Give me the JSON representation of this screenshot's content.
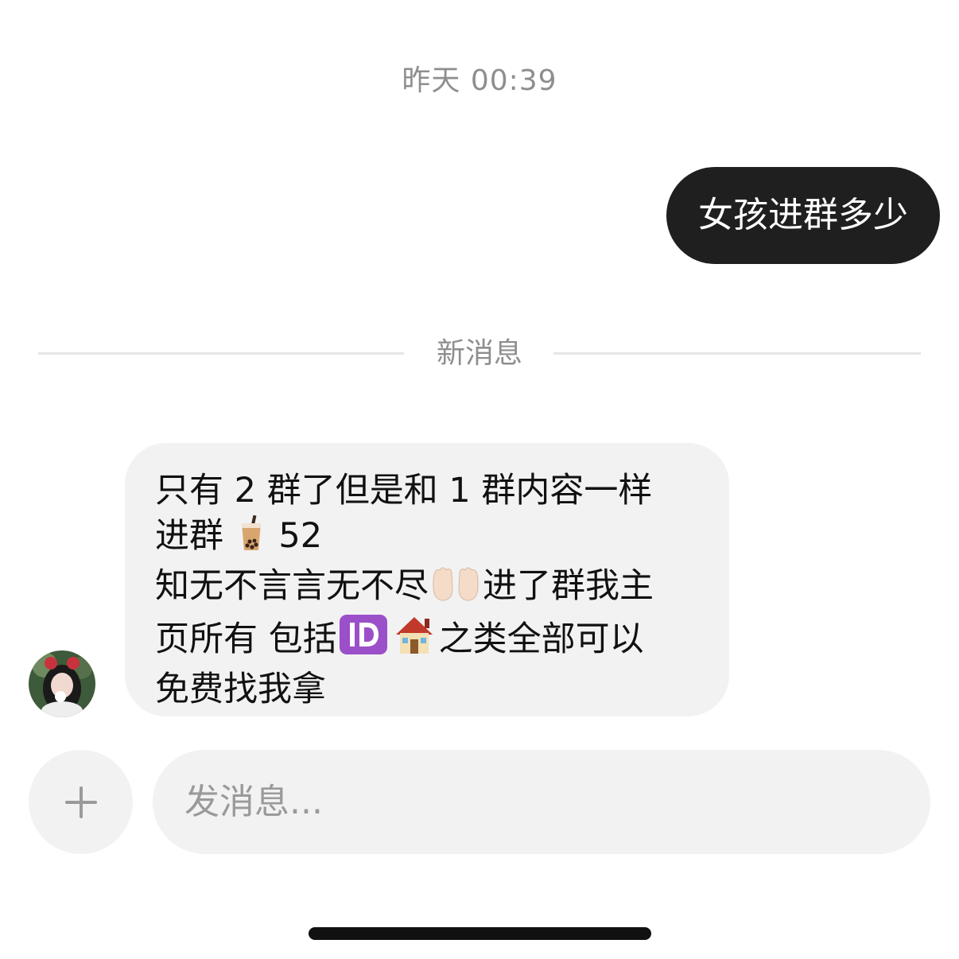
{
  "conversation": {
    "timestamp": "昨天 00:39",
    "outgoing_message": "女孩进群多少",
    "new_messages_divider": "新消息",
    "incoming_message": {
      "line1": "只有 2 群了但是和 1 群内容一样",
      "line2_text": "进群",
      "line2_value": "52",
      "line3_text_a": "知无不言言无不尽",
      "line3_text_b": "进了群我主",
      "line4_text_a": "页所有 包括",
      "line4_text_b": "之类全部可以",
      "line5": "免费找我拿",
      "emoji_icons": [
        "bubble-tea-icon",
        "palms-up-icon",
        "id-icon",
        "house-icon"
      ]
    }
  },
  "composer": {
    "placeholder": "发消息...",
    "add_button_icon": "plus-icon"
  },
  "colors": {
    "outgoing_bubble": "#1f1f1f",
    "incoming_bubble": "#f2f2f2",
    "muted_text": "#8e8e8e"
  }
}
